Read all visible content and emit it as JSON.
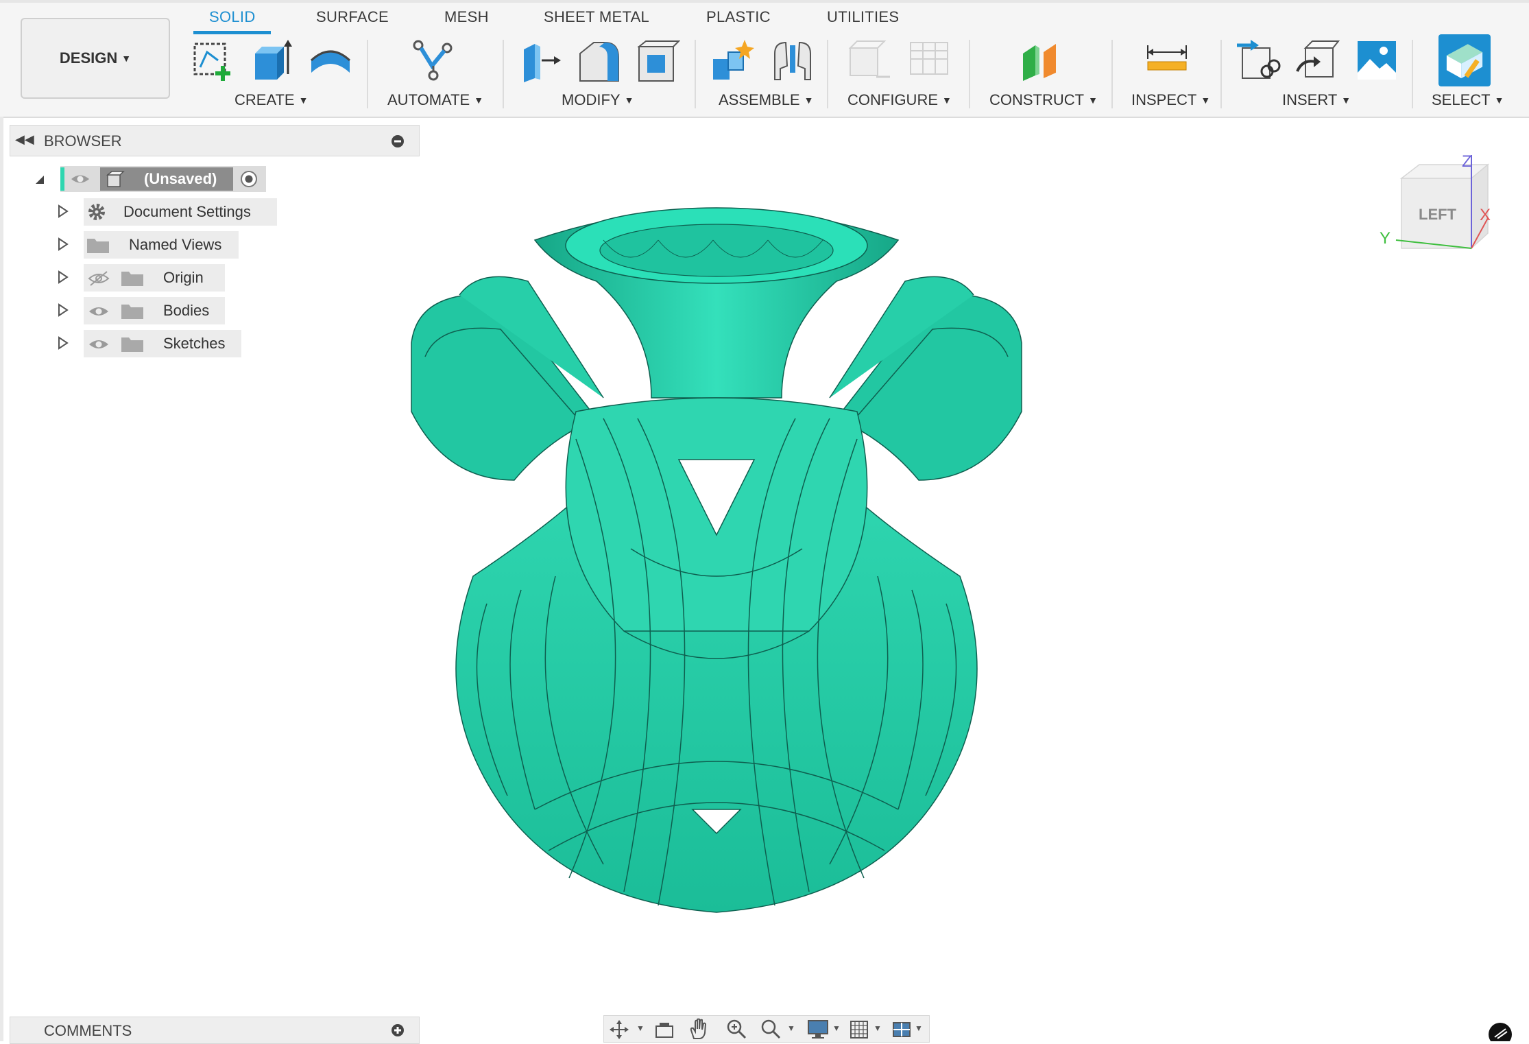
{
  "app": {
    "workspace_label": "DESIGN",
    "accent_color": "#1d8fd1",
    "model_color": "#2fd6b0"
  },
  "tabs": [
    {
      "label": "SOLID",
      "active": true
    },
    {
      "label": "SURFACE"
    },
    {
      "label": "MESH"
    },
    {
      "label": "SHEET METAL"
    },
    {
      "label": "PLASTIC"
    },
    {
      "label": "UTILITIES"
    }
  ],
  "groups": {
    "create": "CREATE",
    "automate": "AUTOMATE",
    "modify": "MODIFY",
    "assemble": "ASSEMBLE",
    "configure": "CONFIGURE",
    "construct": "CONSTRUCT",
    "inspect": "INSPECT",
    "insert": "INSERT",
    "select": "SELECT"
  },
  "browser": {
    "title": "BROWSER",
    "root": "(Unsaved)",
    "items": [
      {
        "label": "Document Settings",
        "icon": "gear-icon"
      },
      {
        "label": "Named Views",
        "icon": "folder-icon"
      },
      {
        "label": "Origin",
        "icon": "folder-icon",
        "visibility": "hidden"
      },
      {
        "label": "Bodies",
        "icon": "folder-icon",
        "visibility": "visible"
      },
      {
        "label": "Sketches",
        "icon": "folder-icon",
        "visibility": "visible"
      }
    ]
  },
  "viewcube": {
    "face": "LEFT",
    "axis_z": "Z",
    "axis_x": "X",
    "axis_y": "Y"
  },
  "comments": {
    "title": "COMMENTS"
  }
}
